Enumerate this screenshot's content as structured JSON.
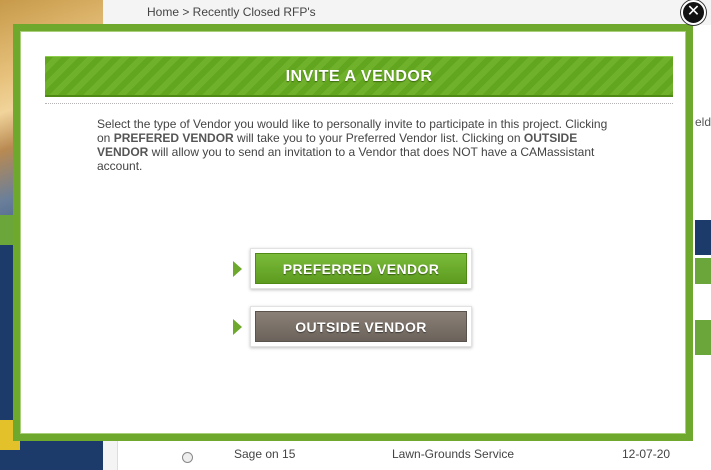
{
  "background": {
    "breadcrumb": "Home >  Recently Closed RFP's",
    "field_label_partial": "eld",
    "row": {
      "name": "Sage on 15",
      "service": "Lawn-Grounds Service",
      "date": "12-07-20"
    }
  },
  "modal": {
    "close_icon": "close-icon",
    "title": "INVITE A VENDOR",
    "description_parts": {
      "p1": "Select the type of Vendor you would like to personally invite to participate in this project.  Clicking on ",
      "b1": "PREFERED VENDOR",
      "p2": " will take you to your Preferred Vendor list.  Clicking on ",
      "b2": "OUTSIDE VENDOR",
      "p3": " will allow you to send an invitation to a Vendor that does NOT have a CAMassistant account."
    },
    "buttons": {
      "preferred": "PREFERRED VENDOR",
      "outside": "OUTSIDE VENDOR"
    }
  },
  "colors": {
    "accent_green": "#6ea82c",
    "outside_button_gray": "#7a7068"
  }
}
